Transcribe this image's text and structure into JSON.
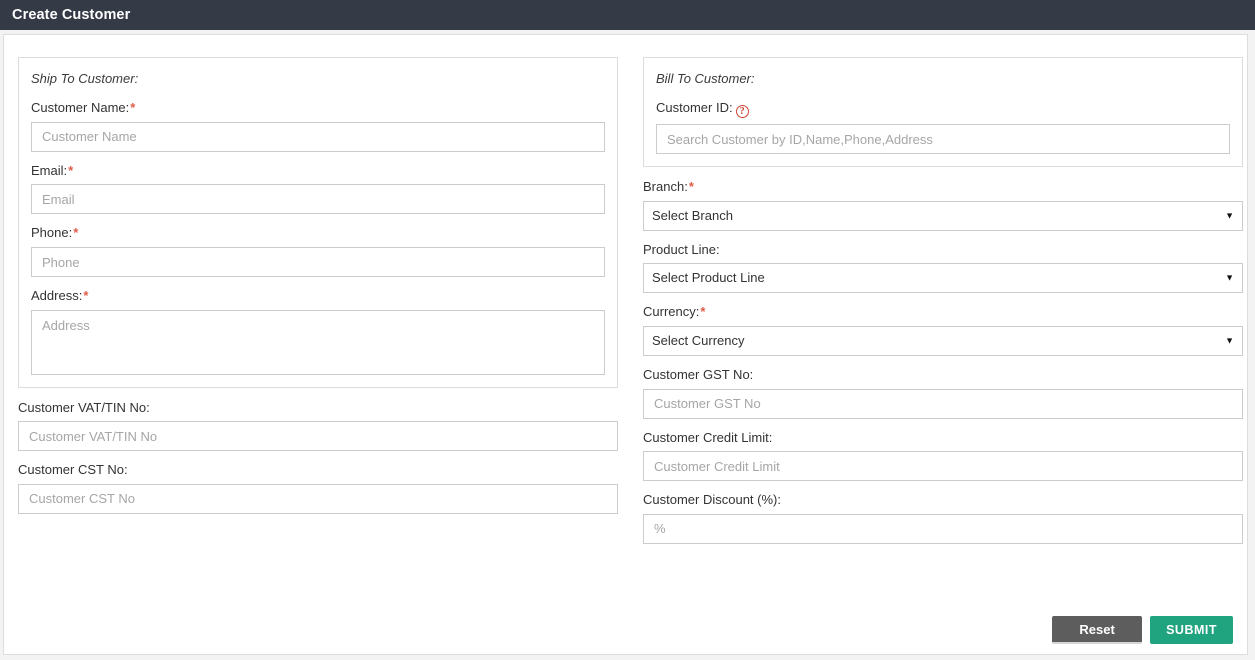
{
  "window": {
    "title": "Create Customer"
  },
  "ship_to_panel": {
    "legend": "Ship To Customer:",
    "fields": [
      {
        "label": "Customer Name:",
        "required": true,
        "placeholder": "Customer Name",
        "type": "input"
      },
      {
        "label": "Email:",
        "required": true,
        "placeholder": "Email",
        "type": "input"
      },
      {
        "label": "Phone:",
        "required": true,
        "placeholder": "Phone",
        "type": "input"
      },
      {
        "label": "Address:",
        "required": true,
        "placeholder": "Address",
        "type": "textarea"
      }
    ]
  },
  "ship_to_extra": {
    "fields": [
      {
        "label": "Customer VAT/TIN No:",
        "required": false,
        "placeholder": "Customer VAT/TIN No",
        "type": "input"
      },
      {
        "label": "Customer CST No:",
        "required": false,
        "placeholder": "Customer CST No",
        "type": "input"
      }
    ]
  },
  "bill_to_panel": {
    "legend": "Bill To Customer:",
    "customer_id": {
      "label": "Customer ID:",
      "help_icon": "question-mark-circle-icon",
      "help_glyph": "?",
      "placeholder": "Search Customer by ID,Name,Phone,Address"
    }
  },
  "bill_to_extra": {
    "fields": [
      {
        "label": "Branch:",
        "required": true,
        "type": "select",
        "value": "Select Branch"
      },
      {
        "label": "Product Line:",
        "required": false,
        "type": "select",
        "value": "Select Product Line"
      },
      {
        "label": "Currency:",
        "required": true,
        "type": "select",
        "value": "Select Currency"
      },
      {
        "label": "Customer GST No:",
        "required": false,
        "type": "input",
        "placeholder": "Customer GST No"
      },
      {
        "label": "Customer Credit Limit:",
        "required": false,
        "type": "input",
        "placeholder": "Customer Credit Limit"
      },
      {
        "label": "Customer Discount (%):",
        "required": false,
        "type": "input",
        "placeholder": "%"
      }
    ]
  },
  "footer": {
    "reset_label": "Reset",
    "submit_label": "SUBMIT"
  },
  "icons": {
    "dropdown_arrow": "chevron-down-icon",
    "dropdown_glyph": "▼"
  },
  "colors": {
    "titlebar": "#343a46",
    "required_asterisk": "#e05c4a",
    "help_icon": "#cf4436",
    "reset_button": "#5d5d5d",
    "submit_button": "#20a37f",
    "border": "#cccccc",
    "placeholder": "#a6a6a6"
  }
}
